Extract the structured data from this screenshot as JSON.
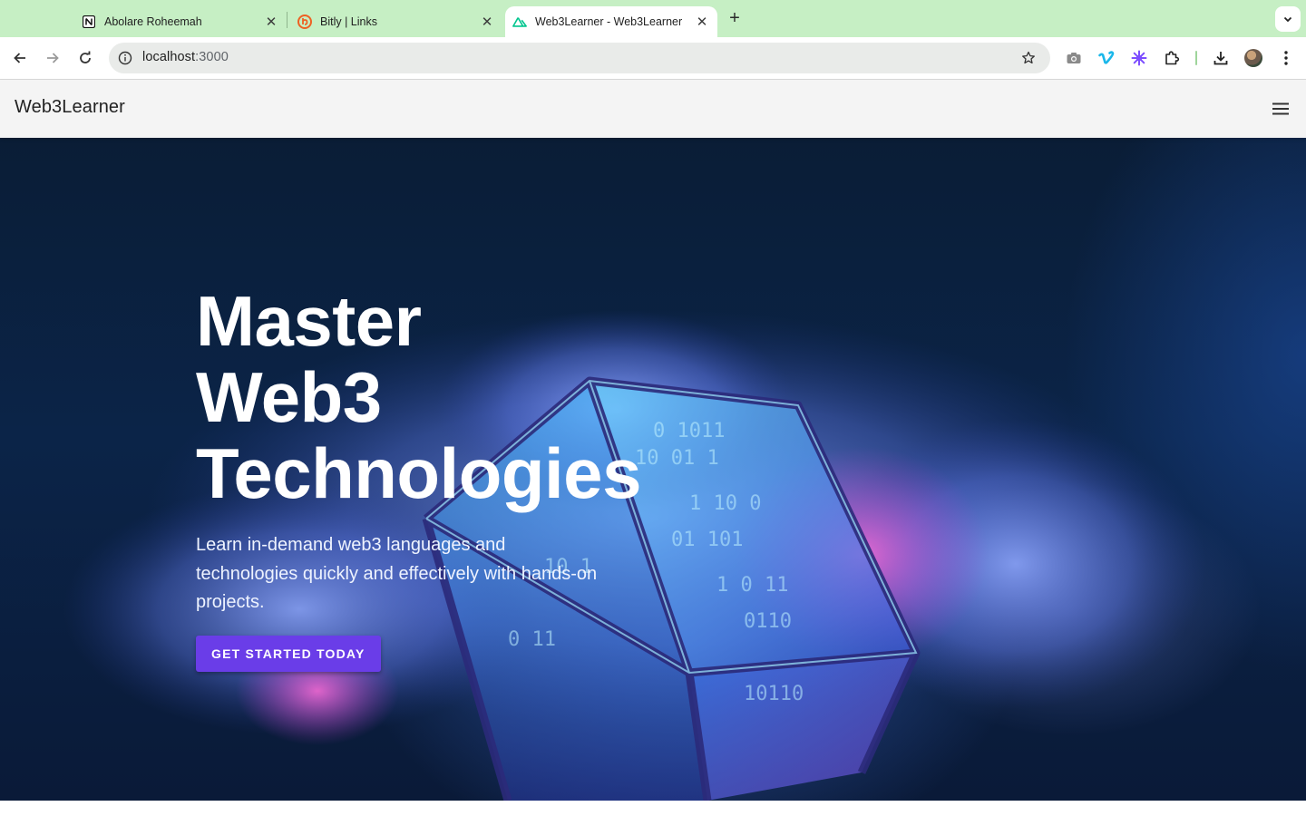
{
  "browser": {
    "tabs": [
      {
        "title": "Abolare Roheemah",
        "favicon": "notion-icon",
        "active": false
      },
      {
        "title": "Bitly | Links",
        "favicon": "bitly-icon",
        "active": false
      },
      {
        "title": "Web3Learner - Web3Learner",
        "favicon": "nuxt-icon",
        "active": true
      }
    ],
    "new_tab": "+",
    "address": {
      "host": "localhost",
      "port": ":3000"
    },
    "toolbar_icons": [
      "back-icon",
      "forward-icon",
      "reload-icon",
      "site-info-icon",
      "bookmark-star-icon",
      "screenshot-camera-icon",
      "vimeo-extension-icon",
      "purple-gear-extension-icon",
      "extensions-puzzle-icon",
      "download-icon",
      "profile-avatar",
      "menu-dots-icon"
    ],
    "colors": {
      "tabstrip": "#c6efc4",
      "active_tab": "#ffffff"
    }
  },
  "app": {
    "brand": "Web3Learner",
    "menu_icon": "hamburger-menu-icon"
  },
  "hero": {
    "title_lines": [
      "Master",
      "Web3",
      "Technologies"
    ],
    "subtitle": "Learn in-demand web3 languages and technologies quickly and effectively with hands-on projects.",
    "cta_label": "GET STARTED TODAY",
    "background": "glowing-binary-cube-in-cloud-image",
    "colors": {
      "cta": "#6a3de8",
      "bg_dark": "#0a1d36"
    }
  }
}
